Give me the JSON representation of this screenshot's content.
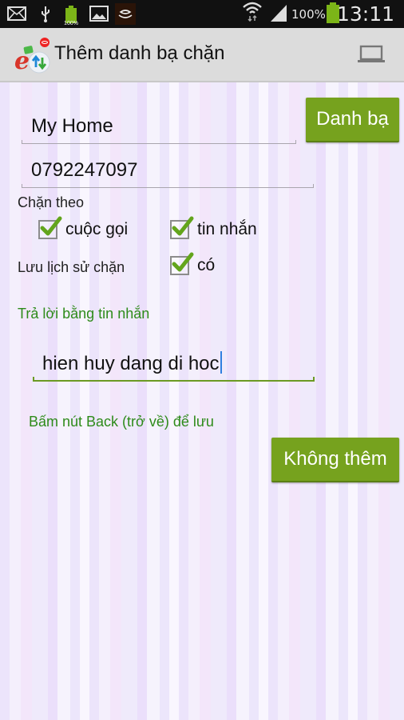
{
  "status_bar": {
    "left_icons": [
      "mail-icon",
      "usb-icon",
      "battery-100-icon",
      "image-icon",
      "coffee-icon"
    ],
    "battery_small_label": "100%",
    "wifi_icon": "wifi-icon",
    "signal_icon": "signal-icon",
    "battery_percent": "100%",
    "time": "13:11"
  },
  "action_bar": {
    "app_icon": "app-logo-icon",
    "title": "Thêm danh bạ chặn",
    "action_icon": "laptop-icon"
  },
  "form": {
    "name_value": "My Home",
    "phone_value": "0792247097",
    "contacts_button": "Danh bạ",
    "block_by_label": "Chặn theo",
    "block_options": [
      {
        "label": "cuộc gọi",
        "checked": true
      },
      {
        "label": "tin nhắn",
        "checked": true
      }
    ],
    "log_label": "Lưu lịch sử chặn",
    "log_option": {
      "label": "có",
      "checked": true
    },
    "reply_label": "Trả lời bằng tin nhắn",
    "reply_value": "hien huy dang di hoc",
    "hint": "Bấm nút Back (trở về) để lưu",
    "cancel_button": "Không thêm"
  },
  "colors": {
    "accent_green": "#76a21e",
    "label_green": "#2e8b1a",
    "caret_blue": "#2f7fe0"
  }
}
